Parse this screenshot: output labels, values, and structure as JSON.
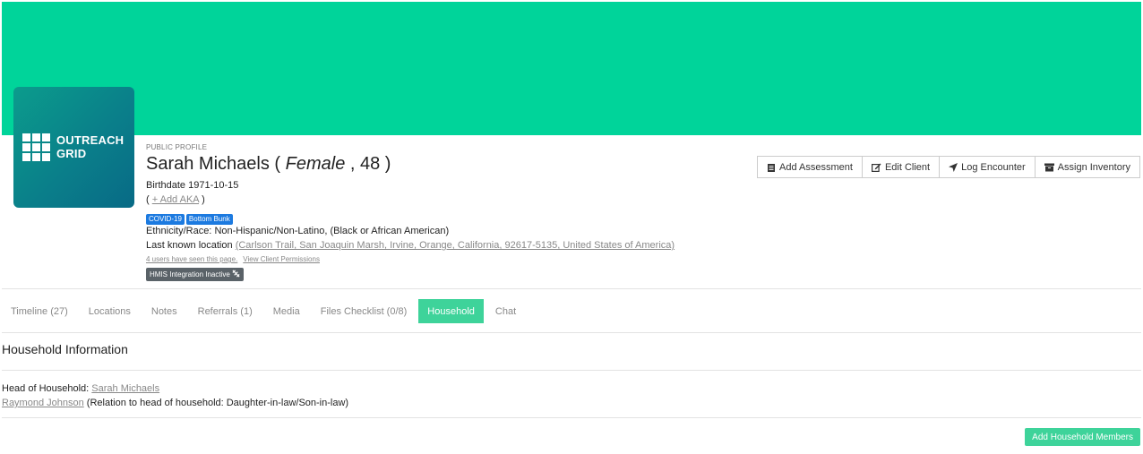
{
  "logo": {
    "line1": "OUTREACH",
    "line2": "GRID"
  },
  "profile": {
    "label": "PUBLIC PROFILE",
    "name": "Sarah Michaels",
    "gender": "Female",
    "age": "48",
    "birthdate_label": "Birthdate",
    "birthdate": "1971-10-15",
    "add_aka": "+ Add AKA",
    "tags": [
      "COVID-19",
      "Bottom Bunk"
    ],
    "ethnicity_label": "Ethnicity/Race:",
    "ethnicity": "Non-Hispanic/Non-Latino, (Black or African American)",
    "location_label": "Last known location",
    "location": "(Carlson Trail, San Joaquin Marsh, Irvine, Orange, California, 92617-5135, United States of America)",
    "seen": "4 users have seen this page.",
    "permissions": "View Client Permissions",
    "hmis": "HMIS Integration Inactive"
  },
  "actions": {
    "add_assessment": "Add Assessment",
    "edit_client": "Edit Client",
    "log_encounter": "Log Encounter",
    "assign_inventory": "Assign Inventory"
  },
  "tabs": [
    {
      "label": "Timeline (27)"
    },
    {
      "label": "Locations"
    },
    {
      "label": "Notes"
    },
    {
      "label": "Referrals (1)"
    },
    {
      "label": "Media"
    },
    {
      "label": "Files Checklist (0/8)"
    },
    {
      "label": "Household"
    },
    {
      "label": "Chat"
    }
  ],
  "active_tab": "Household",
  "household": {
    "title": "Household Information",
    "head_label": "Head of Household:",
    "head_name": "Sarah Michaels",
    "member_name": "Raymond Johnson",
    "member_relation": "(Relation to head of household: Daughter-in-law/Son-in-law)",
    "add_button": "Add Household Members"
  },
  "colors": {
    "brand": "#00d49a",
    "accent": "#3ed39a",
    "tag": "#1c7ae0",
    "hmis": "#5a6268"
  }
}
